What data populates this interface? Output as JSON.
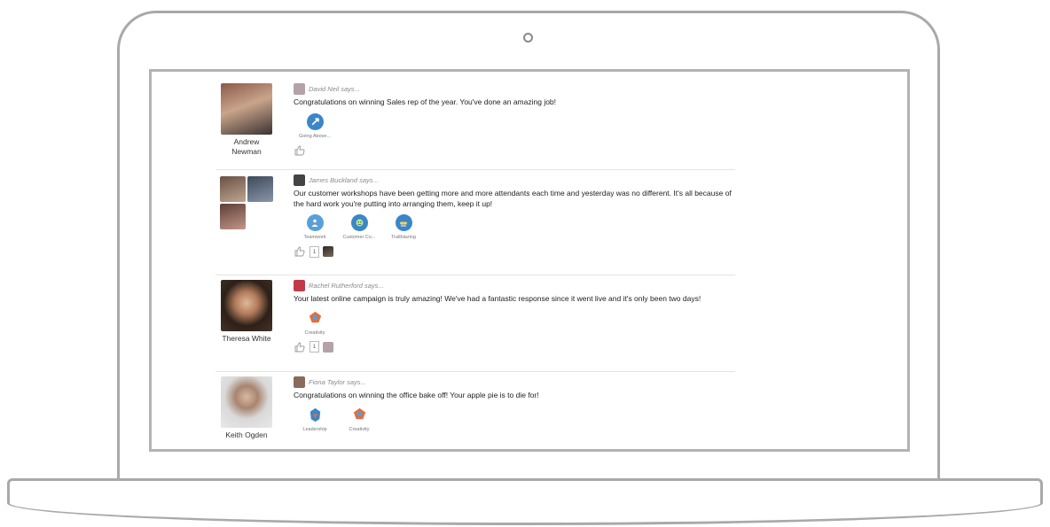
{
  "posts": [
    {
      "recipient_name": "Andrew Newman",
      "author": "David Neil says...",
      "message": "Congratulations on winning Sales rep of the year. You've done an amazing job!",
      "badges": [
        {
          "label": "Going Above...",
          "icon": "rocket-icon",
          "color": "#3b86c8"
        }
      ],
      "like_count": ""
    },
    {
      "recipient_name": "",
      "author": "James Buckland says...",
      "message": "Our customer workshops have been getting more and more attendants each time and yesterday was no different. It's all because of the hard work you're putting into arranging them, keep it up!",
      "badges": [
        {
          "label": "Teamwork",
          "icon": "teamwork-icon",
          "color": "#3b86c8"
        },
        {
          "label": "Customer Co...",
          "icon": "customer-icon",
          "color": "#3b86c8"
        },
        {
          "label": "Trailblazing",
          "icon": "trailblazing-icon",
          "color": "#3b86c8"
        }
      ],
      "like_count": "1"
    },
    {
      "recipient_name": "Theresa White",
      "author": "Rachel Rutherford says...",
      "message": "Your latest online campaign is truly amazing! We've had a fantastic response since it went live and it's only been two days!",
      "badges": [
        {
          "label": "Creativity",
          "icon": "creativity-icon",
          "color": "#e86c3a"
        }
      ],
      "like_count": "1"
    },
    {
      "recipient_name": "Keith Ogden",
      "author": "Fiona Taylor says...",
      "message": "Congratulations on winning the office bake off! Your apple pie is to die for!",
      "badges": [
        {
          "label": "Leadership",
          "icon": "leadership-icon",
          "color": "#3b86c8"
        },
        {
          "label": "Creativity",
          "icon": "creativity-icon",
          "color": "#e86c3a"
        }
      ],
      "like_count": ""
    }
  ]
}
